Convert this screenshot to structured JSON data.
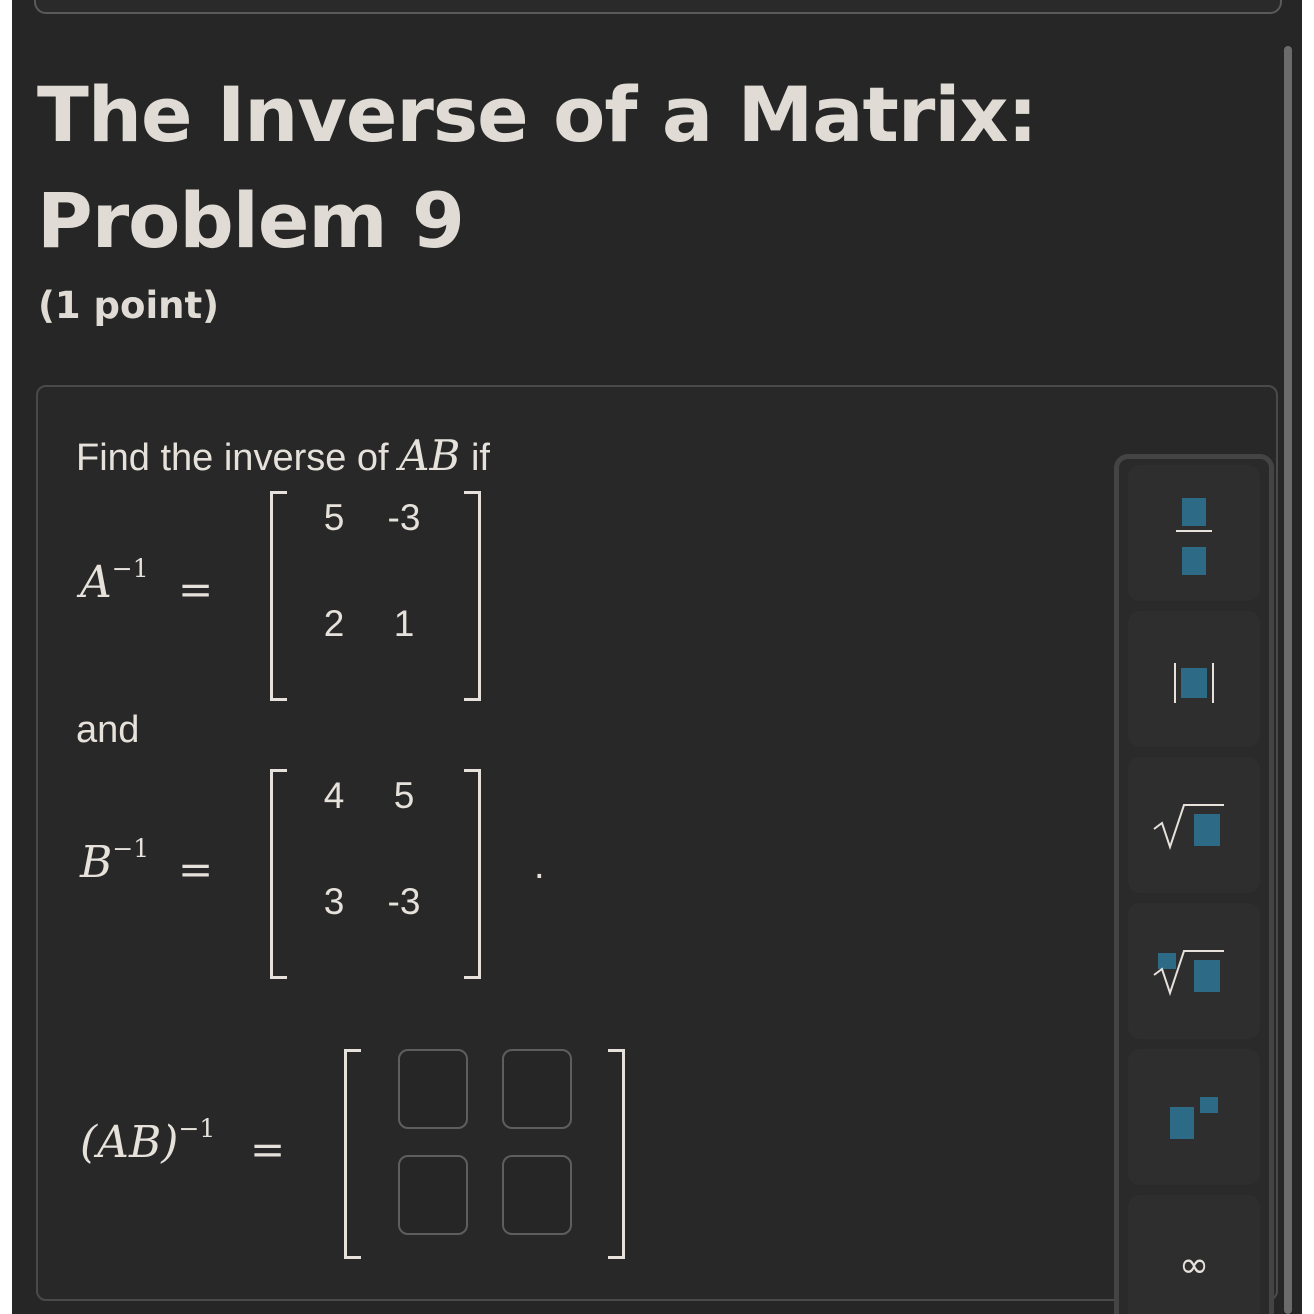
{
  "title": "The Inverse of a Matrix: Problem 9",
  "points": "(1 point)",
  "problem": {
    "intro_prefix": "Find the inverse of",
    "intro_var": "AB",
    "intro_suffix": "if",
    "a_inv": {
      "base": "A",
      "exp": "−1",
      "eq": "=",
      "matrix": [
        [
          "5",
          "-3"
        ],
        [
          "2",
          "1"
        ]
      ]
    },
    "and_label": "and",
    "b_inv": {
      "base": "B",
      "exp": "−1",
      "eq": "=",
      "matrix": [
        [
          "4",
          "5"
        ],
        [
          "3",
          "-3"
        ]
      ]
    },
    "period": ".",
    "answer": {
      "lhs": "(AB)",
      "exp": "−1",
      "eq": "=",
      "cells": [
        "",
        "",
        "",
        ""
      ]
    }
  },
  "toolbar": {
    "tools": [
      "fraction",
      "absolute-value",
      "square-root",
      "nth-root",
      "exponent",
      "infinity"
    ],
    "infinity_symbol": "∞"
  },
  "colors": {
    "accent": "#2d6a86",
    "background": "#262626",
    "text": "#e6e2db"
  }
}
